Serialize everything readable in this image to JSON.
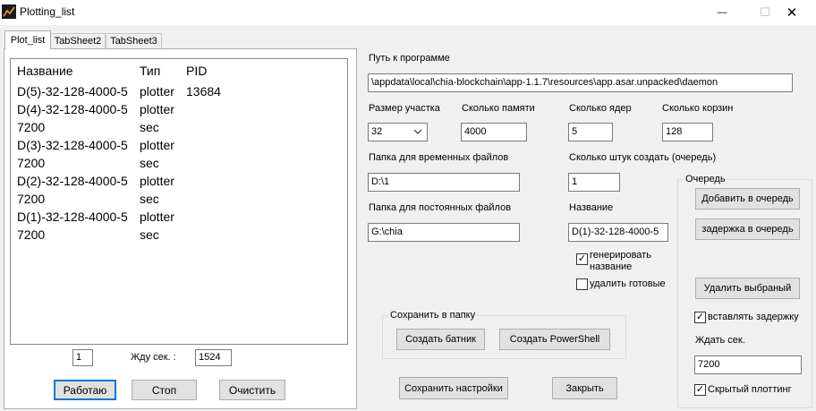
{
  "window": {
    "title": "Plotting_list",
    "minimize_glyph": "—",
    "maximize_glyph": "☐",
    "close_glyph": "✕"
  },
  "tabs": [
    {
      "label": "Plot_list"
    },
    {
      "label": "TabSheet2"
    },
    {
      "label": "TabSheet3"
    }
  ],
  "list": {
    "columns": [
      "Название",
      "Тип",
      "PID"
    ],
    "rows": [
      [
        "D(5)-32-128-4000-5",
        "plotter",
        "13684"
      ],
      [
        "D(4)-32-128-4000-5",
        "plotter",
        ""
      ],
      [
        "7200",
        "sec",
        ""
      ],
      [
        "D(3)-32-128-4000-5",
        "plotter",
        ""
      ],
      [
        "7200",
        "sec",
        ""
      ],
      [
        "D(2)-32-128-4000-5",
        "plotter",
        ""
      ],
      [
        "7200",
        "sec",
        ""
      ],
      [
        "D(1)-32-128-4000-5",
        "plotter",
        ""
      ],
      [
        "7200",
        "sec",
        ""
      ]
    ]
  },
  "bottom": {
    "counter_value": "1",
    "wait_label": "Жду сек. :",
    "wait_value": "1524",
    "work_button": "Работаю",
    "stop_button": "Стоп",
    "clear_button": "Очистить"
  },
  "settings": {
    "program_path_label": "Путь к программе",
    "program_path_value": "\\appdata\\local\\chia-blockchain\\app-1.1.7\\resources\\app.asar.unpacked\\daemon",
    "plot_size_label": "Размер участка",
    "plot_size_value": "32",
    "memory_label": "Сколько памяти",
    "memory_value": "4000",
    "cores_label": "Сколько ядер",
    "cores_value": "5",
    "buckets_label": "Сколько корзин",
    "buckets_value": "128",
    "temp_folder_label": "Папка для временных файлов",
    "temp_folder_value": "D:\\1",
    "count_label": "Сколько штук создать (очередь)",
    "count_value": "1",
    "final_folder_label": "Папка для постоянных файлов",
    "final_folder_value": "G:\\chia",
    "name_label": "Название",
    "name_value": "D(1)-32-128-4000-5",
    "generate_name_line1": "генерировать",
    "generate_name_line2": "название",
    "generate_name_checked": true,
    "delete_done_label": "удалить готовые",
    "delete_done_checked": false
  },
  "save_group": {
    "title": "Сохранить в папку",
    "create_bat_button": "Создать батник",
    "create_ps_button": "Создать PowerShell"
  },
  "actions": {
    "save_settings_button": "Сохранить настройки",
    "close_button": "Закрыть"
  },
  "queue": {
    "title": "Очередь",
    "add_button": "Добавить в очередь",
    "delay_button": "задержка в очередь",
    "delete_button": "Удалить выбраный",
    "insert_delay_label": "вставлять задержку",
    "insert_delay_checked": true,
    "wait_label": "Ждать сек.",
    "wait_value": "7200",
    "hidden_label": "Скрытый плоттинг",
    "hidden_checked": true
  },
  "colors": {
    "tab_border": "#adadad",
    "default_button_border": "#0078d7",
    "window_bg": "#f0f0f0"
  },
  "icons": {
    "app": "chia-plot-icon",
    "check": "check-icon",
    "dropdown": "chevron-down-icon"
  }
}
